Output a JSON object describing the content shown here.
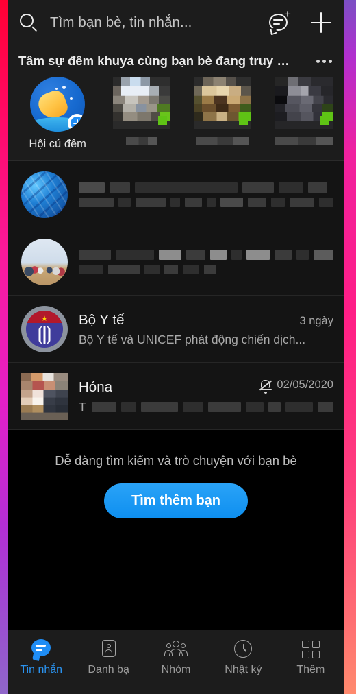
{
  "app": {
    "name": "Zalo",
    "accent_color": "#1f8df5",
    "background_color": "#000000",
    "panel_color": "#1c1c1c",
    "list_color": "#141414"
  },
  "topbar": {
    "search_icon": "search-icon",
    "search_placeholder": "Tìm bạn bè, tin nhắn...",
    "new_message_icon": "new-message-icon",
    "add_icon": "plus-icon"
  },
  "stories": {
    "title": "Tâm sự đêm khuya cùng bạn bè đang truy c...",
    "more_icon": "more-options-icon",
    "items": [
      {
        "label": "Hội cú đêm",
        "type": "create",
        "icon": "night-owl-moon-icon",
        "badge": "plus-badge",
        "censored": false
      },
      {
        "label": "",
        "type": "friend",
        "censored": true,
        "online": true
      },
      {
        "label": "",
        "type": "friend",
        "censored": true,
        "online": true
      },
      {
        "label": "",
        "type": "friend",
        "censored": true,
        "online": true
      }
    ]
  },
  "conversations": [
    {
      "name": "",
      "preview": "",
      "time": "",
      "avatar": "tech-blue-avatar",
      "censored": true,
      "muted": false
    },
    {
      "name": "",
      "preview": "",
      "time": "",
      "avatar": "beach-group-avatar",
      "censored": true,
      "muted": false
    },
    {
      "name": "Bộ Y tế",
      "preview": "Bộ Y tế và UNICEF phát động chiến dịch...",
      "time": "3 ngày",
      "avatar": "ministry-of-health-logo",
      "censored": false,
      "muted": false
    },
    {
      "name": "Hóna",
      "preview": "T",
      "time": "02/05/2020",
      "avatar": "person-avatar",
      "censored": true,
      "muted": true,
      "mute_icon": "bell-muted-icon"
    }
  ],
  "promo": {
    "text": "Dễ dàng tìm kiếm và trò chuyện với bạn bè",
    "button_label": "Tìm thêm bạn"
  },
  "bottom_nav": {
    "active_index": 0,
    "items": [
      {
        "label": "Tin nhắn",
        "icon": "message-bubble-icon"
      },
      {
        "label": "Danh bạ",
        "icon": "contact-card-icon"
      },
      {
        "label": "Nhóm",
        "icon": "people-group-icon"
      },
      {
        "label": "Nhật ký",
        "icon": "clock-history-icon"
      },
      {
        "label": "Thêm",
        "icon": "grid-more-icon"
      }
    ]
  }
}
